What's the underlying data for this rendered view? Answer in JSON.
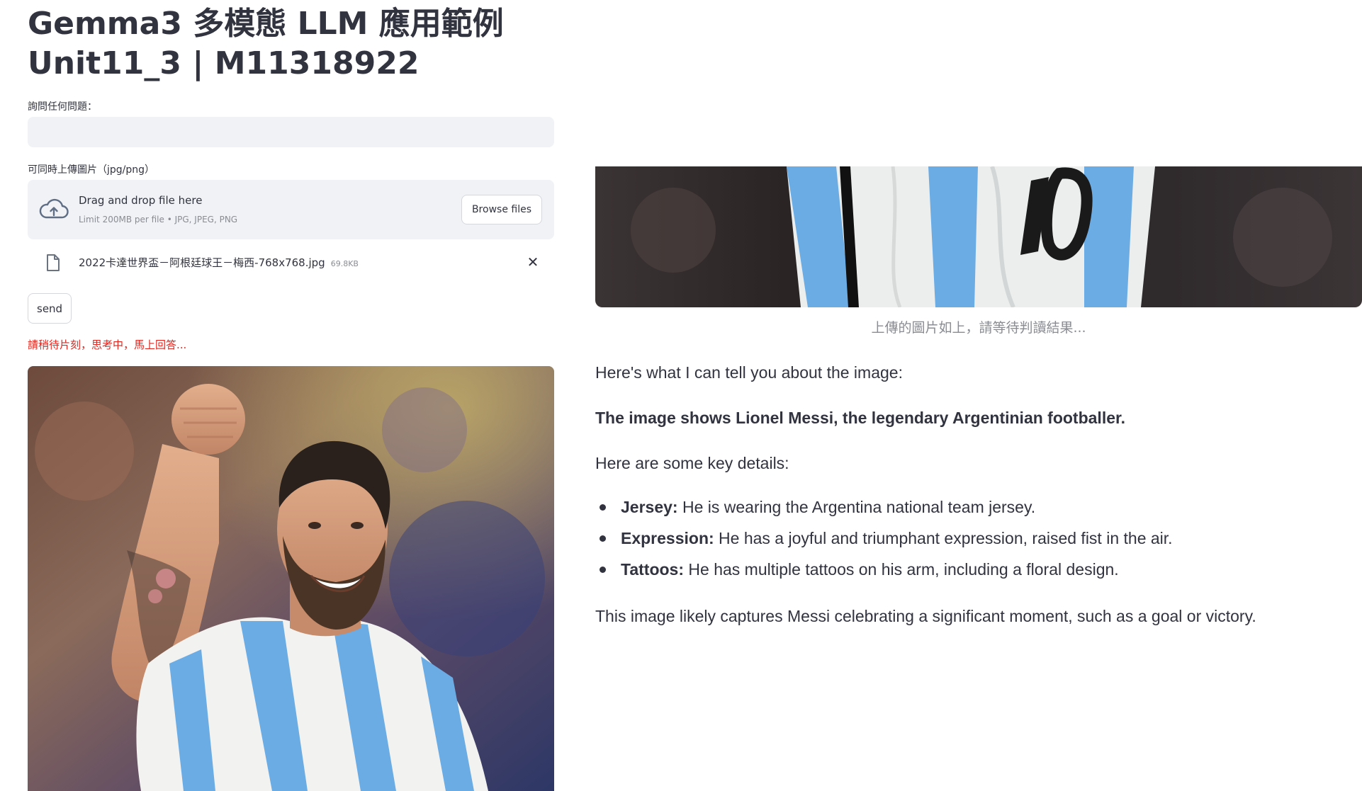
{
  "header": {
    "title_line1": "Gemma3 多模態 LLM 應用範例",
    "title_line2": "Unit11_3 | M11318922"
  },
  "question": {
    "label": "詢問任何問題：",
    "value": "",
    "placeholder": ""
  },
  "uploader": {
    "label": "可同時上傳圖片（jpg/png）",
    "dropzone_title": "Drag and drop file here",
    "dropzone_subtitle": "Limit 200MB per file • JPG, JPEG, PNG",
    "browse_label": "Browse files",
    "file_name": "2022卡達世界盃－阿根廷球王－梅西-768x768.jpg",
    "file_size": "69.8KB"
  },
  "send_label": "send",
  "waiting_message": "請稍待片刻，思考中，馬上回答...",
  "result": {
    "caption": "上傳的圖片如上，請等待判讀結果...",
    "intro": "Here's what I can tell you about the image:",
    "headline": "The image shows Lionel Messi, the legendary Argentinian footballer.",
    "details_intro": "Here are some key details:",
    "details": [
      {
        "key": "Jersey:",
        "text": " He is wearing the Argentina national team jersey."
      },
      {
        "key": "Expression:",
        "text": " He has a joyful and triumphant expression, raised fist in the air."
      },
      {
        "key": "Tattoos:",
        "text": " He has multiple tattoos on his arm, including a floral design."
      }
    ],
    "conclusion": "This image likely captures Messi celebrating a significant moment, such as a goal or victory."
  },
  "colors": {
    "text": "#31333f",
    "input_bg": "#f0f2f6",
    "warning_red": "#e0271f",
    "muted": "#8a8c93",
    "jersey_blue": "#6cace4"
  },
  "icons": {
    "upload": "cloud-upload-icon",
    "file": "file-icon",
    "remove": "close-icon"
  }
}
